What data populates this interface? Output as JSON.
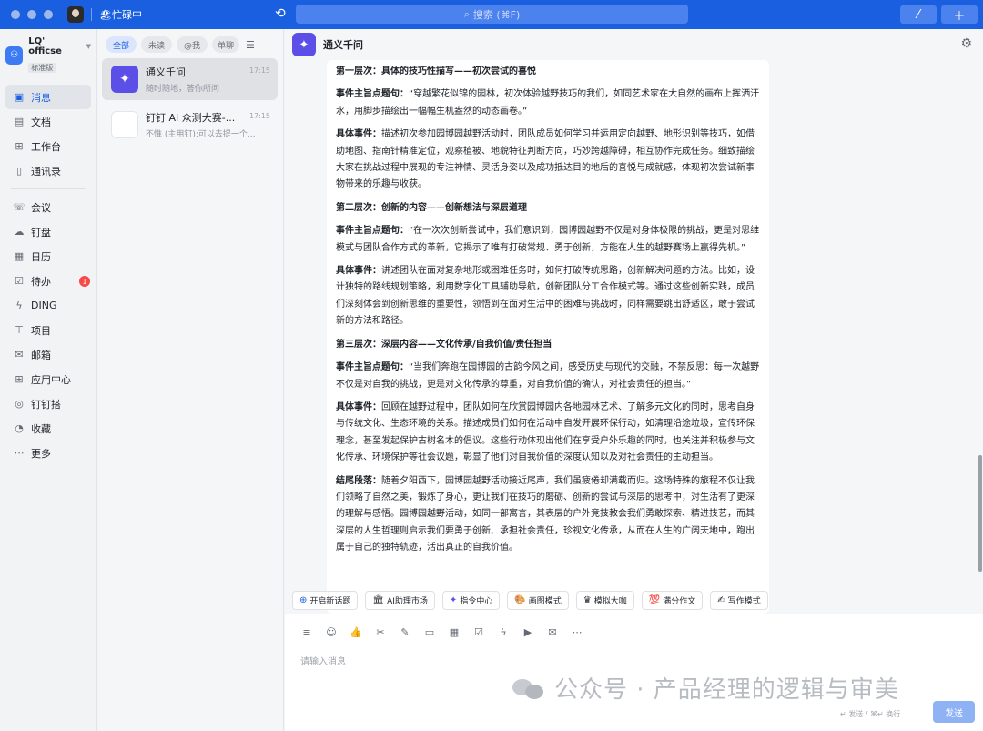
{
  "topbar": {
    "status": "🏖忙碌中",
    "search_placeholder": "搜索 (⌘F)",
    "search_icon": "magnifier-icon",
    "history_icon": "history-icon",
    "btn1_icon": "shortcut-icon",
    "btn2_icon": "plus-icon"
  },
  "org": {
    "name": "LQ' officse",
    "badge": "标准版"
  },
  "nav": {
    "items": [
      {
        "label": "消息",
        "icon": "message-icon"
      },
      {
        "label": "文档",
        "icon": "doc-icon"
      },
      {
        "label": "工作台",
        "icon": "workbench-icon"
      },
      {
        "label": "通讯录",
        "icon": "contacts-icon"
      },
      {
        "label": "会议",
        "icon": "meeting-icon"
      },
      {
        "label": "钉盘",
        "icon": "cloud-drive-icon"
      },
      {
        "label": "日历",
        "icon": "calendar-icon"
      },
      {
        "label": "待办",
        "icon": "todo-icon",
        "badge": "1"
      },
      {
        "label": "DING",
        "icon": "ding-icon"
      },
      {
        "label": "项目",
        "icon": "project-icon"
      },
      {
        "label": "邮箱",
        "icon": "mail-icon"
      },
      {
        "label": "应用中心",
        "icon": "apps-icon"
      },
      {
        "label": "钉钉搭",
        "icon": "builder-icon"
      },
      {
        "label": "收藏",
        "icon": "favorites-icon"
      },
      {
        "label": "更多",
        "icon": "more-icon"
      }
    ]
  },
  "filters": [
    "全部",
    "未读",
    "@我",
    "单聊"
  ],
  "conversations": [
    {
      "title": "通义千问",
      "subtitle": "随时随地，答你所问",
      "time": "17:15"
    },
    {
      "title": "钉钉 AI 众测大赛-...",
      "subtitle": "不惟 (主用钉):可以去提一个...",
      "time": "17:15"
    }
  ],
  "chat": {
    "title": "通义千问",
    "sections": [
      {
        "heading": "第一层次：具体的技巧性描写——初次尝试的喜悦"
      },
      {
        "label": "事件主旨点题句：",
        "text": "“穿越繁花似锦的园林，初次体验越野技巧的我们，如同艺术家在大自然的画布上挥洒汗水，用脚步描绘出一幅幅生机盎然的动态画卷。”"
      },
      {
        "label": "具体事件：",
        "text": "描述初次参加园博园越野活动时，团队成员如何学习并运用定向越野、地形识别等技巧，如借助地图、指南针精准定位，观察植被、地貌特征判断方向，巧妙跨越障碍，相互协作完成任务。细致描绘大家在挑战过程中展现的专注神情、灵活身姿以及成功抵达目的地后的喜悦与成就感，体现初次尝试新事物带来的乐趣与收获。"
      },
      {
        "heading": "第二层次：创新的内容——创新想法与深层道理"
      },
      {
        "label": "事件主旨点题句：",
        "text": "“在一次次创新尝试中，我们意识到，园博园越野不仅是对身体极限的挑战，更是对思维模式与团队合作方式的革新，它揭示了唯有打破常规、勇于创新，方能在人生的越野赛场上赢得先机。”"
      },
      {
        "label": "具体事件：",
        "text": "讲述团队在面对复杂地形或困难任务时，如何打破传统思路，创新解决问题的方法。比如，设计独特的路线规划策略，利用数字化工具辅助导航，创新团队分工合作模式等。通过这些创新实践，成员们深刻体会到创新思维的重要性，领悟到在面对生活中的困难与挑战时，同样需要跳出舒适区，敢于尝试新的方法和路径。"
      },
      {
        "heading": "第三层次：深层内容——文化传承/自我价值/责任担当"
      },
      {
        "label": "事件主旨点题句：",
        "text": "“当我们奔跑在园博园的古韵今风之间，感受历史与现代的交融，不禁反思：每一次越野不仅是对自我的挑战，更是对文化传承的尊重，对自我价值的确认，对社会责任的担当。”"
      },
      {
        "label": "具体事件：",
        "text": "回顾在越野过程中，团队如何在欣赏园博园内各地园林艺术、了解多元文化的同时，思考自身与传统文化、生态环境的关系。描述成员们如何在活动中自发开展环保行动，如清理沿途垃圾，宣传环保理念，甚至发起保护古树名木的倡议。这些行动体现出他们在享受户外乐趣的同时，也关注并积极参与文化传承、环境保护等社会议题，彰显了他们对自我价值的深度认知以及对社会责任的主动担当。"
      },
      {
        "label": "结尾段落：",
        "text": "随着夕阳西下，园博园越野活动接近尾声，我们虽疲倦却满载而归。这场特殊的旅程不仅让我们领略了自然之美，锻炼了身心，更让我们在技巧的磨砺、创新的尝试与深层的思考中，对生活有了更深的理解与感悟。园博园越野活动，如同一部寓言，其表层的户外竞技教会我们勇敢探索、精进技艺，而其深层的人生哲理则启示我们要勇于创新、承担社会责任，珍视文化传承，从而在人生的广阔天地中，跑出属于自己的独特轨迹，活出真正的自我价值。"
      }
    ]
  },
  "quick_actions": [
    {
      "icon": "plus-circle-icon",
      "label": "开启新话题"
    },
    {
      "icon": "store-icon",
      "label": "AI助理市场"
    },
    {
      "icon": "sparkle-icon",
      "label": "指令中心"
    },
    {
      "icon": "paint-icon",
      "label": "画图模式"
    },
    {
      "icon": "crown-icon",
      "label": "模拟大咖"
    },
    {
      "icon": "hundred-icon",
      "label": "满分作文"
    },
    {
      "icon": "pen-icon",
      "label": "写作模式"
    }
  ],
  "composer": {
    "placeholder": "请输入消息",
    "hint": "↵ 发送 / ⌘↵ 换行",
    "send_label": "发送",
    "tools": [
      "menu-icon",
      "emoji-icon",
      "thumbs-up-icon",
      "scissors-icon",
      "doc-edit-icon",
      "folder-icon",
      "calendar-icon",
      "check-icon",
      "lightning-icon",
      "video-icon",
      "mail-icon",
      "more-icon"
    ]
  },
  "watermark": {
    "text": "公众号 · 产品经理的逻辑与审美",
    "icon": "wechat-icon"
  }
}
